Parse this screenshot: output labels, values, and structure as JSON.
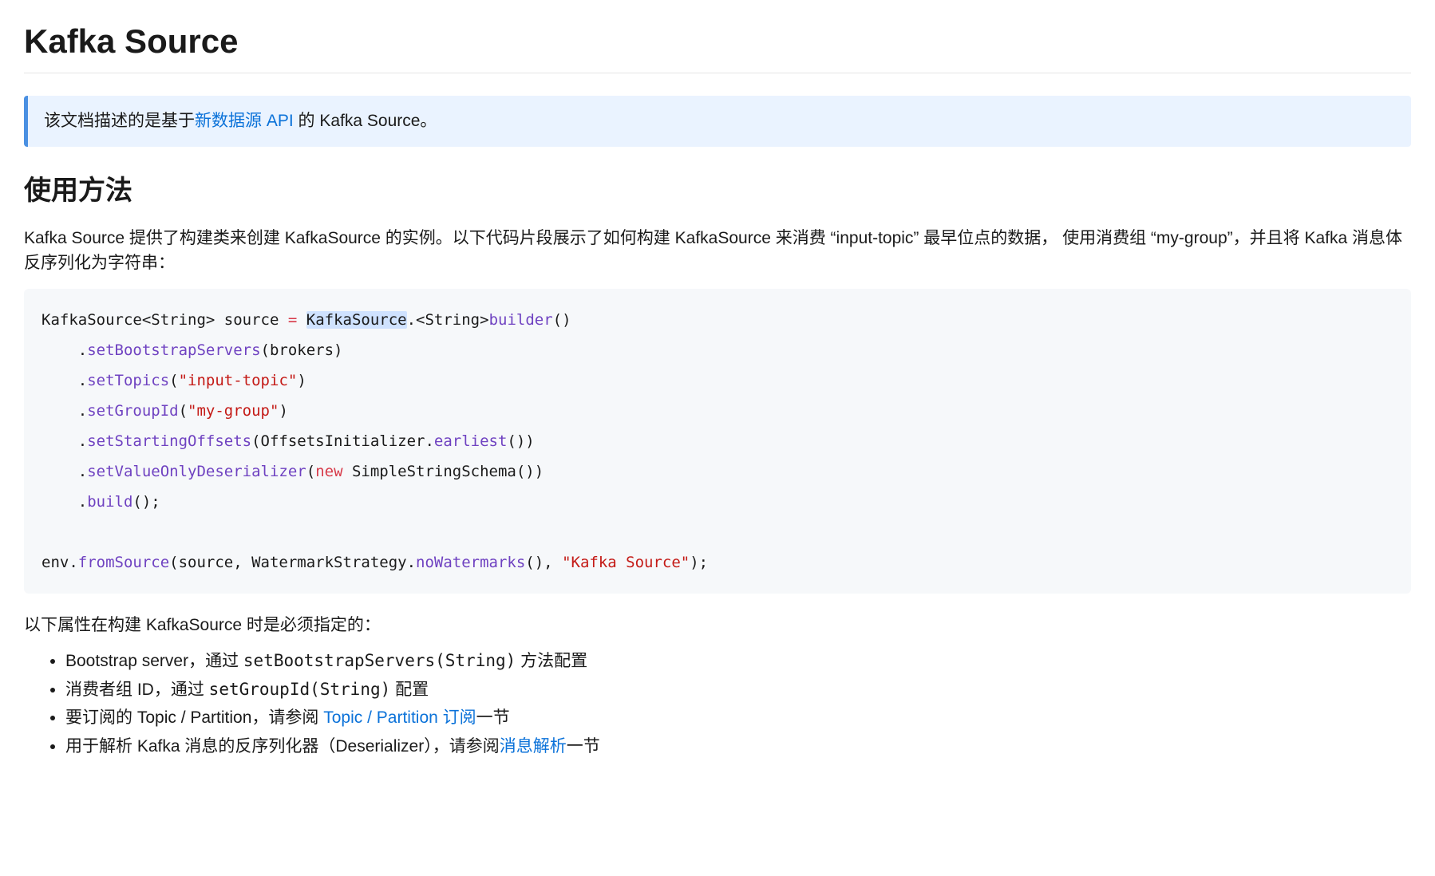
{
  "title": "Kafka Source",
  "infobox": {
    "before": "该文档描述的是基于",
    "link": "新数据源 API",
    "after": " 的 Kafka Source。"
  },
  "usage_heading": "使用方法",
  "intro": "Kafka Source 提供了构建类来创建 KafkaSource 的实例。以下代码片段展示了如何构建 KafkaSource 来消费 “input-topic” 最早位点的数据，  使用消费组 “my-group”，并且将 Kafka 消息体反序列化为字符串：",
  "code": {
    "l1_a": "KafkaSource<String> source ",
    "l1_eq": "=",
    "l1_sp": " ",
    "l1_hl": "KafkaSource",
    "l1_b": ".<String>",
    "l1_c": "builder",
    "l1_d": "()",
    "l2_a": "    .",
    "l2_b": "setBootstrapServers",
    "l2_c": "(brokers)",
    "l3_a": "    .",
    "l3_b": "setTopics",
    "l3_c": "(",
    "l3_d": "\"input-topic\"",
    "l3_e": ")",
    "l4_a": "    .",
    "l4_b": "setGroupId",
    "l4_c": "(",
    "l4_d": "\"my-group\"",
    "l4_e": ")",
    "l5_a": "    .",
    "l5_b": "setStartingOffsets",
    "l5_c": "(OffsetsInitializer.",
    "l5_d": "earliest",
    "l5_e": "())",
    "l6_a": "    .",
    "l6_b": "setValueOnlyDeserializer",
    "l6_c": "(",
    "l6_d": "new",
    "l6_e": " SimpleStringSchema())",
    "l7_a": "    .",
    "l7_b": "build",
    "l7_c": "();",
    "l9_a": "env.",
    "l9_b": "fromSource",
    "l9_c": "(source, WatermarkStrategy.",
    "l9_d": "noWatermarks",
    "l9_e": "(), ",
    "l9_f": "\"Kafka Source\"",
    "l9_g": ");"
  },
  "required_intro": "以下属性在构建 KafkaSource 时是必须指定的：",
  "bullets": {
    "b1_a": "Bootstrap server，通过 ",
    "b1_code": "setBootstrapServers(String)",
    "b1_b": " 方法配置",
    "b2_a": "消费者组 ID，通过 ",
    "b2_code": "setGroupId(String)",
    "b2_b": " 配置",
    "b3_a": "要订阅的 Topic / Partition，请参阅 ",
    "b3_link": "Topic / Partition 订阅",
    "b3_b": "一节",
    "b4_a": "用于解析 Kafka 消息的反序列化器（Deserializer），请参阅",
    "b4_link": "消息解析",
    "b4_b": "一节"
  }
}
